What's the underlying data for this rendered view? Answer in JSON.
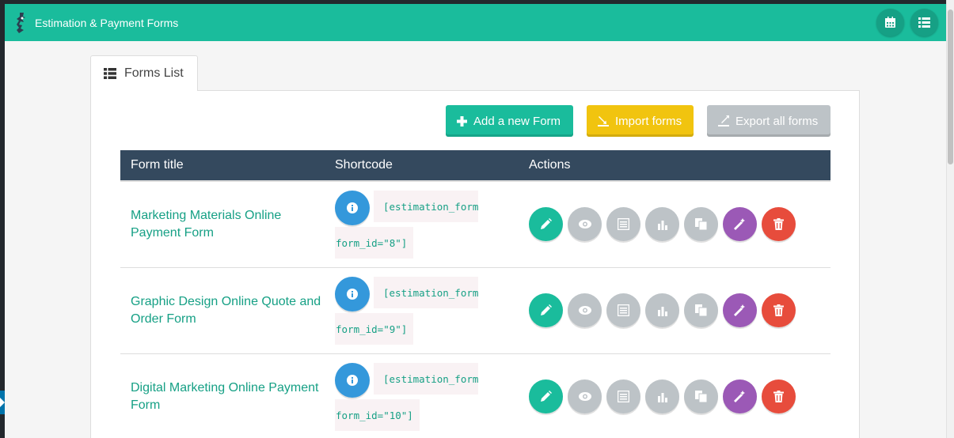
{
  "app": {
    "title": "Estimation & Payment Forms",
    "logo_icon": "wizard-logo-icon",
    "header_buttons": [
      {
        "icon": "calendar-icon"
      },
      {
        "icon": "list-icon"
      }
    ]
  },
  "tab": {
    "label": "Forms List",
    "icon": "list-icon"
  },
  "toolbar": {
    "add_label": "Add a new Form",
    "import_label": "Import forms",
    "export_label": "Export all forms"
  },
  "table": {
    "headers": {
      "title": "Form title",
      "shortcode": "Shortcode",
      "actions": "Actions"
    },
    "rows": [
      {
        "title": "Marketing Materials Online Payment Form",
        "shortcode_line1": "[estimation_form",
        "shortcode_line2": "form_id=\"8\"]"
      },
      {
        "title": "Graphic Design Online Quote and Order Form",
        "shortcode_line1": "[estimation_form",
        "shortcode_line2": "form_id=\"9\"]"
      },
      {
        "title": "Digital Marketing Online Payment Form",
        "shortcode_line1": "[estimation_form",
        "shortcode_line2": "form_id=\"10\"]"
      }
    ]
  },
  "colors": {
    "header": "#1abc9c",
    "table_header": "#34495e",
    "edit": "#1abc9c",
    "info": "#3498db",
    "grey": "#bdc3c7",
    "magic": "#9b59b6",
    "delete": "#e74c3c",
    "import": "#f1c40f"
  }
}
